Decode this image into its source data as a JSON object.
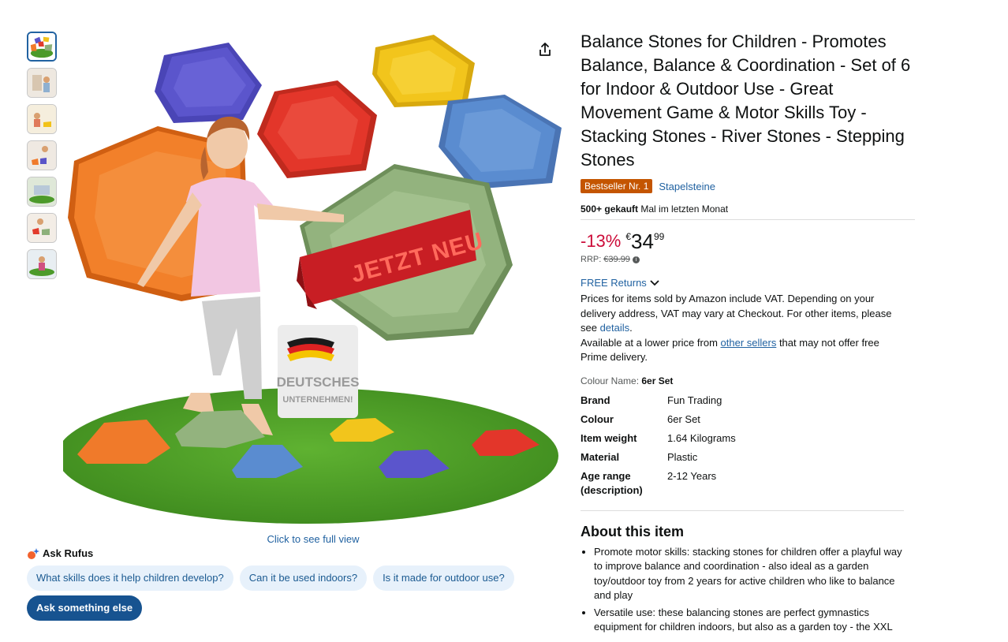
{
  "thumbnails": [
    {
      "name": "thumb-1",
      "active": true
    },
    {
      "name": "thumb-2",
      "active": false
    },
    {
      "name": "thumb-3",
      "active": false
    },
    {
      "name": "thumb-4",
      "active": false
    },
    {
      "name": "thumb-5",
      "active": false
    },
    {
      "name": "thumb-6",
      "active": false
    },
    {
      "name": "thumb-7",
      "active": false
    }
  ],
  "image": {
    "banner_text": "JETZT NEU",
    "sign_line1": "DEUTSCHES",
    "sign_line2": "UNTERNEHMEN!",
    "full_view_link": "Click to see full view"
  },
  "rufus": {
    "title": "Ask Rufus",
    "chips": [
      "What skills does it help children develop?",
      "Can it be used indoors?",
      "Is it made for outdoor use?"
    ],
    "primary": "Ask something else"
  },
  "product": {
    "title": "Balance Stones for Children - Promotes Balance, Balance & Coordination - Set of 6 for Indoor & Outdoor Use - Great Movement Game & Motor Skills Toy - Stacking Stones - River Stones - Stepping Stones",
    "badge": "Bestseller Nr. 1",
    "category": "Stapelsteine",
    "bought_bold": "500+ gekauft",
    "bought_rest": " Mal im letzten Monat",
    "discount": "-13%",
    "currency": "€",
    "price_whole": "34",
    "price_fraction": "99",
    "rrp_label": "RRP:",
    "rrp_value": "€39.99",
    "returns": "FREE Returns",
    "vat_text": "Prices for items sold by Amazon include VAT. Depending on your delivery address, VAT may vary at Checkout. For other items, please see ",
    "vat_link": "details",
    "vat_end": ".",
    "lower_price_pre": "Available at a lower price from ",
    "lower_price_link": "other sellers",
    "lower_price_post": " that may not offer free Prime delivery.",
    "colour_label": "Colour Name: ",
    "colour_value": "6er Set",
    "specs": [
      {
        "k": "Brand",
        "v": "Fun Trading"
      },
      {
        "k": "Colour",
        "v": "6er Set"
      },
      {
        "k": "Item weight",
        "v": "1.64 Kilograms"
      },
      {
        "k": "Material",
        "v": "Plastic"
      },
      {
        "k": "Age range (description)",
        "v": "2-12 Years"
      }
    ],
    "about_title": "About this item",
    "bullets": [
      "Promote motor skills: stacking stones for children offer a playful way to improve balance and coordination - also ideal as a garden toy/outdoor toy from 2 years for active children who like to balance and play",
      "Versatile use: these balancing stones are perfect gymnastics equipment for children indoors, but also as a garden toy - the XXL"
    ]
  },
  "colors": {
    "link": "#2162a1",
    "badge": "#c45500",
    "discount": "#cc0c39",
    "chip_bg": "#e7f1fb",
    "primary_chip": "#175390"
  }
}
